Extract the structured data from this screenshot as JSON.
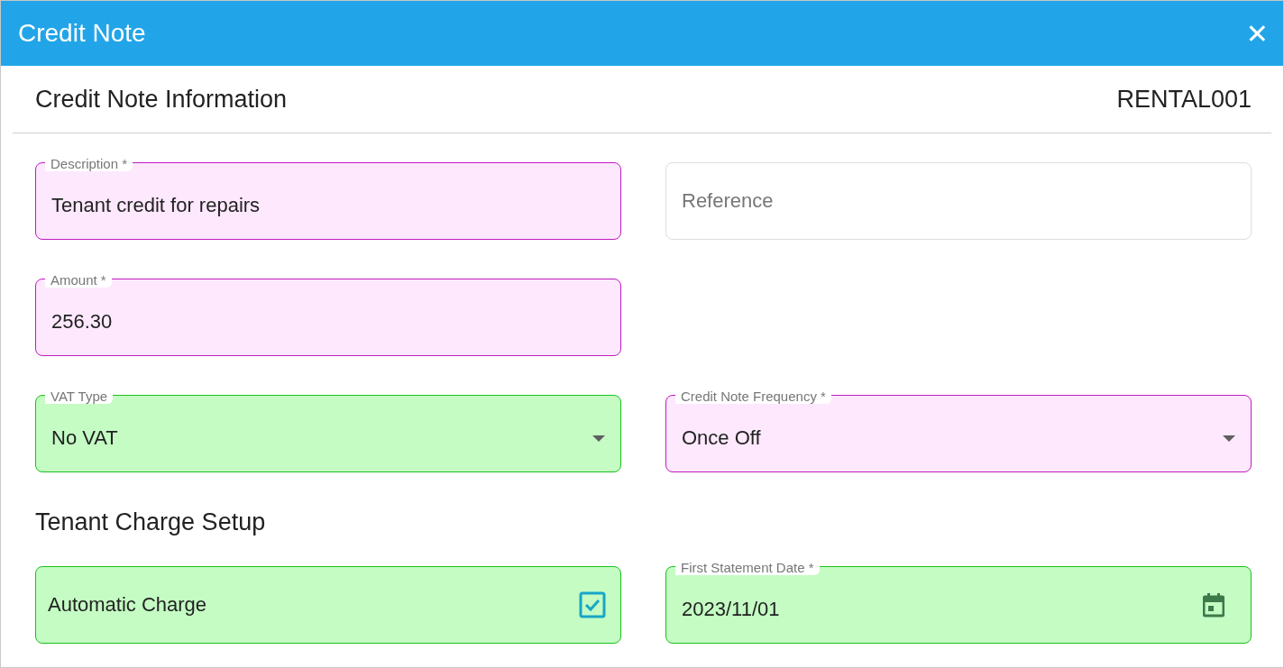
{
  "window": {
    "title": "Credit Note",
    "close_glyph": "✕"
  },
  "section": {
    "title": "Credit Note Information",
    "code": "RENTAL001"
  },
  "rows": [
    {
      "fields": [
        {
          "kind": "text",
          "label": "Description *",
          "value": "Tenant credit for repairs",
          "color": "#fde8fd"
        },
        {
          "kind": "text",
          "placeholder": "Reference"
        }
      ]
    },
    {
      "fields": [
        {
          "kind": "text",
          "label": "Amount *",
          "value": "256.30",
          "color": "#fde8fd"
        }
      ]
    },
    {
      "fields": [
        {
          "kind": "select",
          "label": "VAT Type",
          "value": "No VAT",
          "color": "#c4fcc4"
        },
        {
          "kind": "select",
          "label": "Credit Note Frequency *",
          "value": "Once Off",
          "color": "#fde8fd"
        }
      ]
    }
  ],
  "charge_setup": {
    "title": "Tenant Charge Setup",
    "fields": [
      {
        "kind": "checkbox",
        "value": "Automatic Charge",
        "checked": true,
        "color": "#c4fcc4"
      },
      {
        "kind": "date",
        "label": "First Statement Date *",
        "value": "2023/11/01",
        "color": "#c4fcc4"
      }
    ]
  }
}
